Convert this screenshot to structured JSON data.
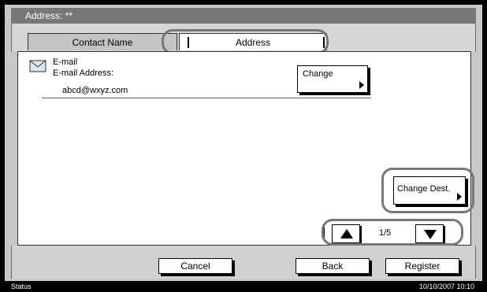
{
  "window": {
    "title": "Address: **"
  },
  "tabs": [
    {
      "label": "Contact Name",
      "selected": false
    },
    {
      "label": "Address",
      "selected": true
    }
  ],
  "entry": {
    "type_label": "E-mail",
    "field_label": "E-mail Address:",
    "value": "abcd@wxyz.com",
    "icon": "envelope-icon",
    "change_label": "Change"
  },
  "actions": {
    "change_dest_label": "Change Dest."
  },
  "pager": {
    "text": "1/5"
  },
  "footer": {
    "cancel": "Cancel",
    "back": "Back",
    "register": "Register"
  },
  "status": {
    "label": "Status",
    "datetime": "10/10/2007  10:10"
  },
  "colors": {
    "frame": "#000000",
    "highlight": "#777777",
    "panel": "#c8c8c8"
  }
}
